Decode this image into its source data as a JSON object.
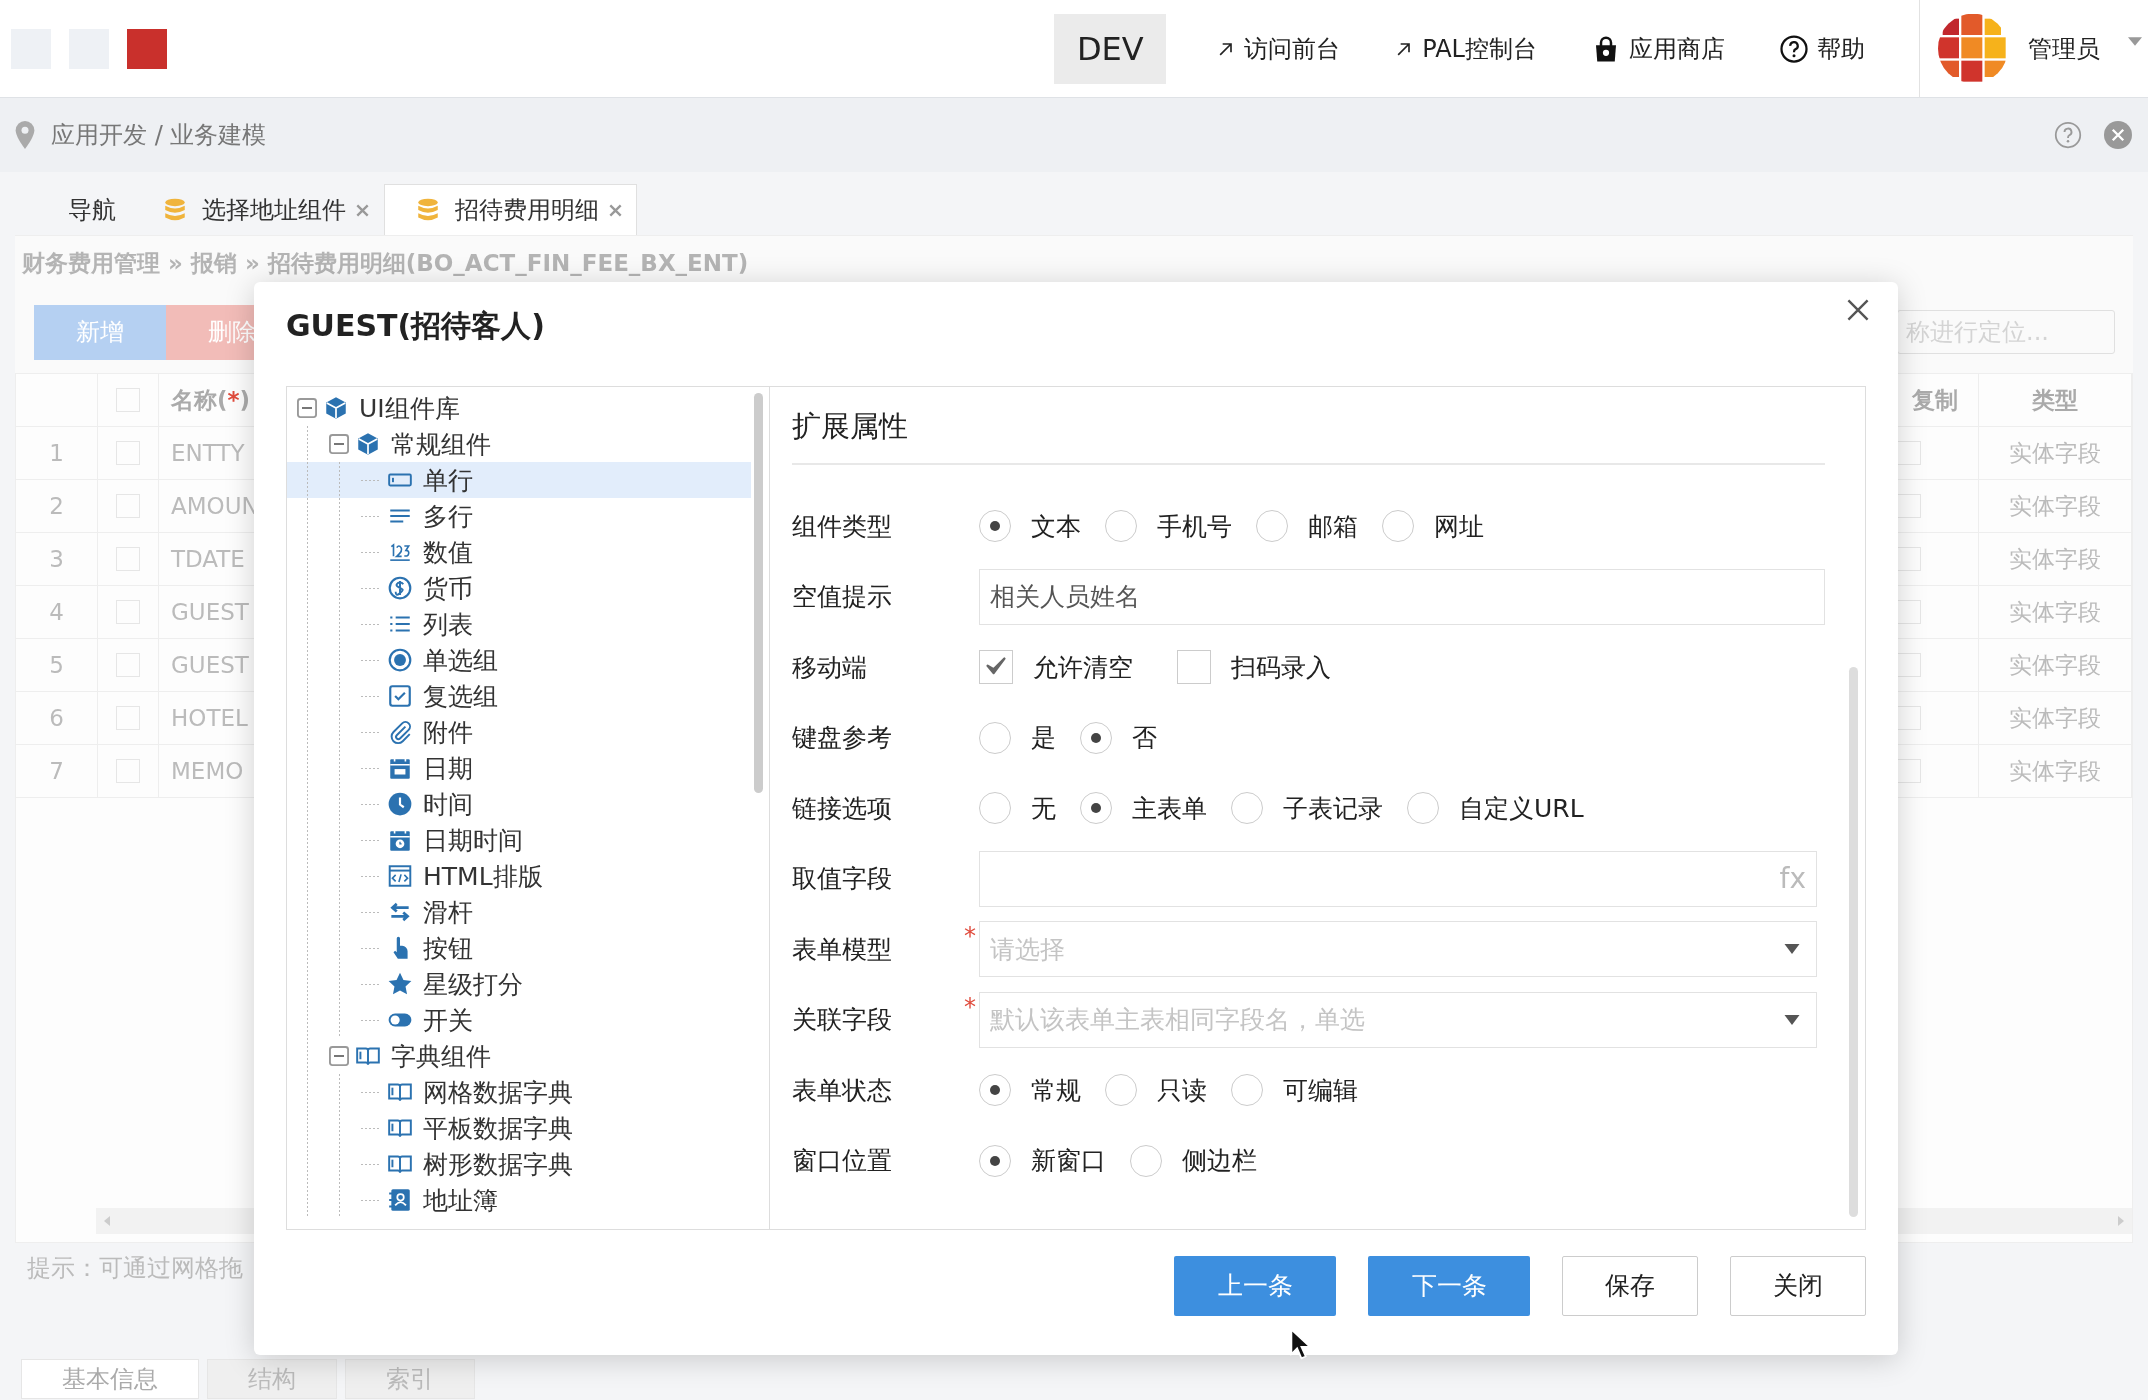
{
  "topbar": {
    "env": "DEV",
    "links": [
      {
        "label": "访问前台",
        "kind": "external"
      },
      {
        "label": "PAL控制台",
        "kind": "external"
      },
      {
        "label": "应用商店",
        "kind": "store"
      },
      {
        "label": "帮助",
        "kind": "help"
      }
    ],
    "user": "管理员"
  },
  "breadcrumb": "应用开发 / 业务建模",
  "tabs": [
    {
      "label": "导航",
      "kind": "nav",
      "closable": false,
      "selected": false
    },
    {
      "label": "选择地址组件",
      "kind": "model",
      "closable": true,
      "selected": false
    },
    {
      "label": "招待费用明细",
      "kind": "model",
      "closable": true,
      "selected": true
    }
  ],
  "path": "财务费用管理 » 报销 » 招待费用明细(BO_ACT_FIN_FEE_BX_ENT)",
  "toolbar": {
    "buttons": [
      {
        "label": "新增",
        "kind": "primary"
      },
      {
        "label": "删除",
        "kind": "danger"
      }
    ],
    "search": {
      "placeholder": "称进行定位..."
    }
  },
  "table": {
    "header_checked": false,
    "columns": [
      {
        "label": "名称(",
        "mark": "*",
        "tail": ")"
      },
      {
        "label": "复制"
      },
      {
        "label": "类型"
      }
    ],
    "rows": [
      {
        "num": "1",
        "name": "ENTTY",
        "checked": false,
        "copy": false,
        "type": "实体字段"
      },
      {
        "num": "2",
        "name": "AMOUN",
        "checked": false,
        "copy": false,
        "type": "实体字段"
      },
      {
        "num": "3",
        "name": "TDATE",
        "checked": false,
        "copy": false,
        "type": "实体字段"
      },
      {
        "num": "4",
        "name": "GUEST",
        "checked": false,
        "copy": false,
        "type": "实体字段"
      },
      {
        "num": "5",
        "name": "GUEST",
        "checked": false,
        "copy": false,
        "type": "实体字段"
      },
      {
        "num": "6",
        "name": "HOTEL",
        "checked": false,
        "copy": false,
        "type": "实体字段"
      },
      {
        "num": "7",
        "name": "MEMO",
        "checked": false,
        "copy": false,
        "type": "实体字段"
      }
    ]
  },
  "hint": "提示：可通过网格拖",
  "bottom_tabs": [
    {
      "label": "基本信息",
      "selected": true
    },
    {
      "label": "结构",
      "selected": false
    },
    {
      "label": "索引",
      "selected": false
    }
  ],
  "modal": {
    "title": "GUEST(招待客人)",
    "tree": [
      {
        "label": "UI组件库",
        "kind": "cube",
        "expanded": true,
        "selected": false,
        "children": [
          {
            "label": "常规组件",
            "kind": "cube",
            "expanded": true,
            "selected": false,
            "children": [
              {
                "label": "单行",
                "kind": "text",
                "selected": true
              },
              {
                "label": "多行",
                "kind": "textarea",
                "selected": false
              },
              {
                "label": "数值",
                "kind": "number",
                "selected": false
              },
              {
                "label": "货币",
                "kind": "currency",
                "selected": false
              },
              {
                "label": "列表",
                "kind": "list",
                "selected": false
              },
              {
                "label": "单选组",
                "kind": "radio",
                "selected": false
              },
              {
                "label": "复选组",
                "kind": "checkbox",
                "selected": false
              },
              {
                "label": "附件",
                "kind": "file",
                "selected": false
              },
              {
                "label": "日期",
                "kind": "date",
                "selected": false
              },
              {
                "label": "时间",
                "kind": "time",
                "selected": false
              },
              {
                "label": "日期时间",
                "kind": "datetime",
                "selected": false
              },
              {
                "label": "HTML排版",
                "kind": "html",
                "selected": false
              },
              {
                "label": "滑杆",
                "kind": "slider",
                "selected": false
              },
              {
                "label": "按钮",
                "kind": "button",
                "selected": false
              },
              {
                "label": "星级打分",
                "kind": "rating",
                "selected": false
              },
              {
                "label": "开关",
                "kind": "switch",
                "selected": false
              }
            ]
          },
          {
            "label": "字典组件",
            "kind": "dictionary",
            "expanded": true,
            "selected": false,
            "children": [
              {
                "label": "网格数据字典",
                "kind": "dictionary",
                "selected": false
              },
              {
                "label": "平板数据字典",
                "kind": "dictionary",
                "selected": false
              },
              {
                "label": "树形数据字典",
                "kind": "dictionary",
                "selected": false
              },
              {
                "label": "地址簿",
                "kind": "address",
                "selected": false
              }
            ]
          }
        ]
      }
    ],
    "section": "扩展属性",
    "fields": [
      {
        "label": "组件类型",
        "kind": "radio",
        "options": [
          {
            "label": "文本",
            "selected": true
          },
          {
            "label": "手机号",
            "selected": false
          },
          {
            "label": "邮箱",
            "selected": false
          },
          {
            "label": "网址",
            "selected": false
          }
        ]
      },
      {
        "label": "空值提示",
        "kind": "text",
        "value": "相关人员姓名"
      },
      {
        "label": "移动端",
        "kind": "checkbox",
        "options": [
          {
            "label": "允许清空",
            "checked": true
          },
          {
            "label": "扫码录入",
            "checked": false
          }
        ]
      },
      {
        "label": "键盘参考",
        "kind": "radio",
        "options": [
          {
            "label": "是",
            "selected": false
          },
          {
            "label": "否",
            "selected": true
          }
        ]
      },
      {
        "label": "链接选项",
        "kind": "radio",
        "options": [
          {
            "label": "无",
            "selected": false
          },
          {
            "label": "主表单",
            "selected": true
          },
          {
            "label": "子表记录",
            "selected": false
          },
          {
            "label": "自定义URL",
            "selected": false
          }
        ]
      },
      {
        "label": "取值字段",
        "kind": "formula",
        "fx": "fx"
      },
      {
        "label": "表单模型",
        "kind": "select",
        "mark": "*",
        "placeholder": "请选择"
      },
      {
        "label": "关联字段",
        "kind": "select",
        "mark": "*",
        "placeholder": "默认该表单主表相同字段名，单选"
      },
      {
        "label": "表单状态",
        "kind": "radio",
        "options": [
          {
            "label": "常规",
            "selected": true
          },
          {
            "label": "只读",
            "selected": false
          },
          {
            "label": "可编辑",
            "selected": false
          }
        ]
      },
      {
        "label": "窗口位置",
        "kind": "radio",
        "options": [
          {
            "label": "新窗口",
            "selected": true
          },
          {
            "label": "侧边栏",
            "selected": false
          }
        ]
      }
    ],
    "buttons": [
      {
        "label": "上一条",
        "kind": "primary"
      },
      {
        "label": "下一条",
        "kind": "primary"
      },
      {
        "label": "保存",
        "kind": "default"
      },
      {
        "label": "关闭",
        "kind": "default"
      }
    ]
  }
}
